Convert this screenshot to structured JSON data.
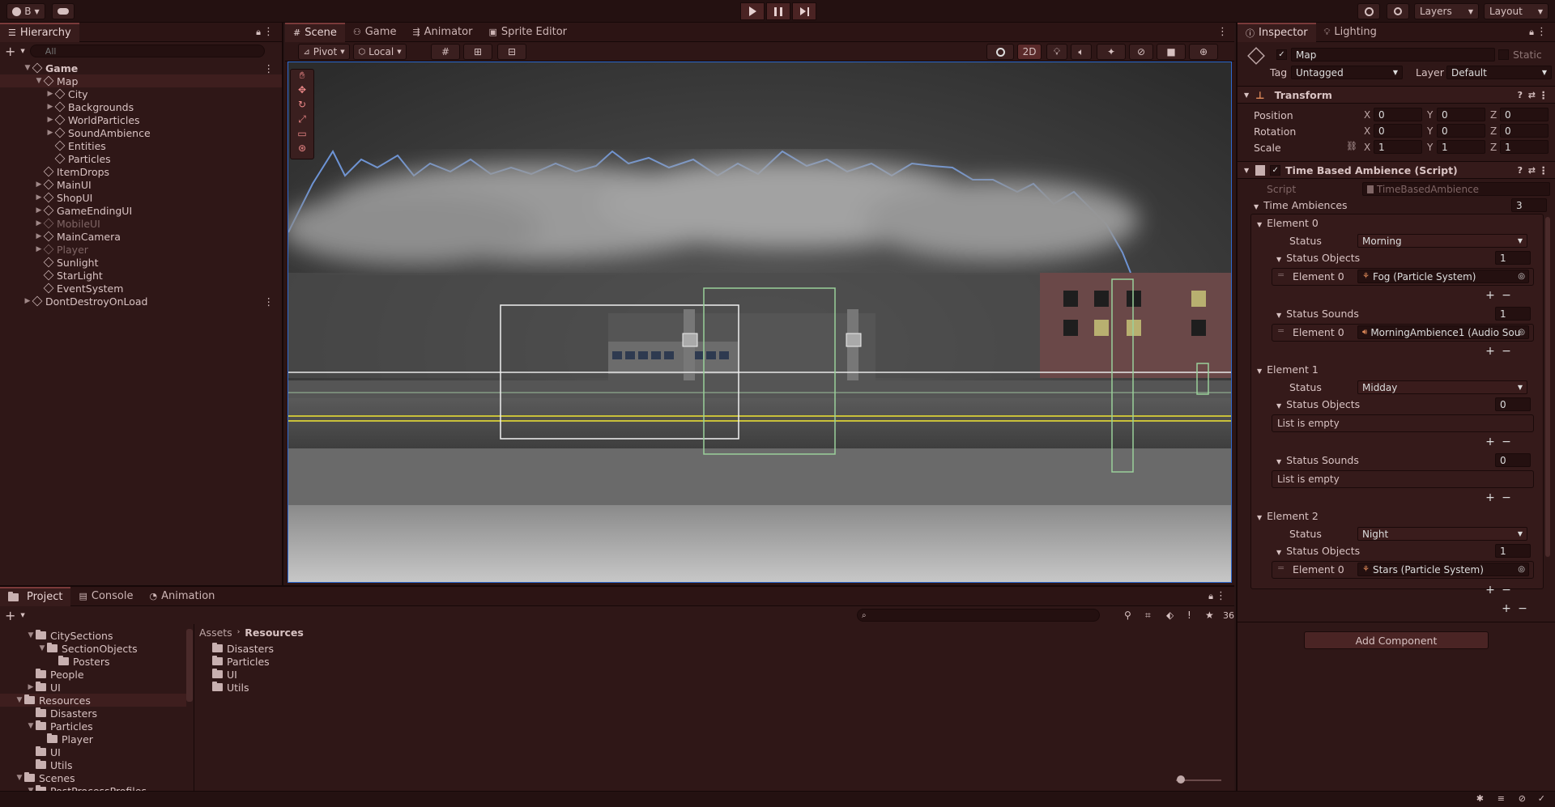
{
  "toolbar": {
    "account": "B",
    "layers": "Layers",
    "layout": "Layout"
  },
  "hierarchy": {
    "title": "Hierarchy",
    "search_placeholder": "All",
    "items": [
      {
        "label": "Game",
        "depth": 0,
        "expanded": true
      },
      {
        "label": "Map",
        "depth": 1,
        "expanded": true
      },
      {
        "label": "City",
        "depth": 2
      },
      {
        "label": "Backgrounds",
        "depth": 2
      },
      {
        "label": "WorldParticles",
        "depth": 2
      },
      {
        "label": "SoundAmbience",
        "depth": 2
      },
      {
        "label": "Entities",
        "depth": 2
      },
      {
        "label": "Particles",
        "depth": 2
      },
      {
        "label": "ItemDrops",
        "depth": 1
      },
      {
        "label": "MainUI",
        "depth": 1
      },
      {
        "label": "ShopUI",
        "depth": 1
      },
      {
        "label": "GameEndingUI",
        "depth": 1
      },
      {
        "label": "MobileUI",
        "depth": 1
      },
      {
        "label": "MainCamera",
        "depth": 1
      },
      {
        "label": "Player",
        "depth": 1
      },
      {
        "label": "Sunlight",
        "depth": 1
      },
      {
        "label": "StarLight",
        "depth": 1
      },
      {
        "label": "EventSystem",
        "depth": 1
      },
      {
        "label": "DontDestroyOnLoad",
        "depth": 0
      }
    ]
  },
  "scene": {
    "tabs": [
      "Scene",
      "Game",
      "Animator",
      "Sprite Editor"
    ],
    "pivot": "Pivot",
    "local": "Local",
    "mode_2d": "2D"
  },
  "inspector": {
    "tabs": [
      "Inspector",
      "Lighting"
    ],
    "object_name": "Map",
    "static_label": "Static",
    "tag_label": "Tag",
    "tag": "Untagged",
    "layer_label": "Layer",
    "layer": "Default",
    "transform": {
      "title": "Transform",
      "position_label": "Position",
      "position": [
        "0",
        "0",
        "0"
      ],
      "rotation_label": "Rotation",
      "rotation": [
        "0",
        "0",
        "0"
      ],
      "scale_label": "Scale",
      "scale": [
        "1",
        "1",
        "1"
      ]
    },
    "script_comp": {
      "title": "Time Based Ambience (Script)",
      "script_label": "Script",
      "script_value": "TimeBasedAmbience",
      "list_label": "Time Ambiences",
      "list_count": "3",
      "status_label": "Status",
      "objects_label": "Status Objects",
      "sounds_label": "Status Sounds",
      "empty_text": "List is empty",
      "elements": [
        {
          "label": "Element 0",
          "status": "Morning",
          "objects_count": "1",
          "object0": "Fog (Particle System)",
          "sounds_count": "1",
          "sound0": "MorningAmbience1 (Audio Sou"
        },
        {
          "label": "Element 1",
          "status": "Midday",
          "objects_count": "0",
          "sounds_count": "0"
        },
        {
          "label": "Element 2",
          "status": "Night",
          "objects_count": "1",
          "object0": "Stars (Particle System)"
        }
      ],
      "sub_element_label": "Element 0"
    },
    "add_component": "Add Component"
  },
  "project": {
    "tabs": [
      "Project",
      "Console",
      "Animation"
    ],
    "breadcrumb": [
      "Assets",
      "Resources"
    ],
    "count": "36",
    "tree": [
      {
        "label": "CitySections",
        "depth": 1,
        "arrow": "▼"
      },
      {
        "label": "SectionObjects",
        "depth": 2,
        "arrow": "▼"
      },
      {
        "label": "Posters",
        "depth": 3,
        "arrow": ""
      },
      {
        "label": "People",
        "depth": 1,
        "arrow": ""
      },
      {
        "label": "UI",
        "depth": 1,
        "arrow": "▶"
      },
      {
        "label": "Resources",
        "depth": 0,
        "arrow": "▼",
        "selected": true
      },
      {
        "label": "Disasters",
        "depth": 1,
        "arrow": ""
      },
      {
        "label": "Particles",
        "depth": 1,
        "arrow": "▼"
      },
      {
        "label": "Player",
        "depth": 2,
        "arrow": ""
      },
      {
        "label": "UI",
        "depth": 1,
        "arrow": ""
      },
      {
        "label": "Utils",
        "depth": 1,
        "arrow": ""
      },
      {
        "label": "Scenes",
        "depth": 0,
        "arrow": "▼"
      },
      {
        "label": "PostProcessProfiles",
        "depth": 1,
        "arrow": "▼"
      }
    ],
    "contents": [
      "Disasters",
      "Particles",
      "UI",
      "Utils"
    ]
  },
  "colors": {
    "accent": "#7a3a3a",
    "bg": "#2f1717",
    "selection": "#2d6ad0"
  }
}
